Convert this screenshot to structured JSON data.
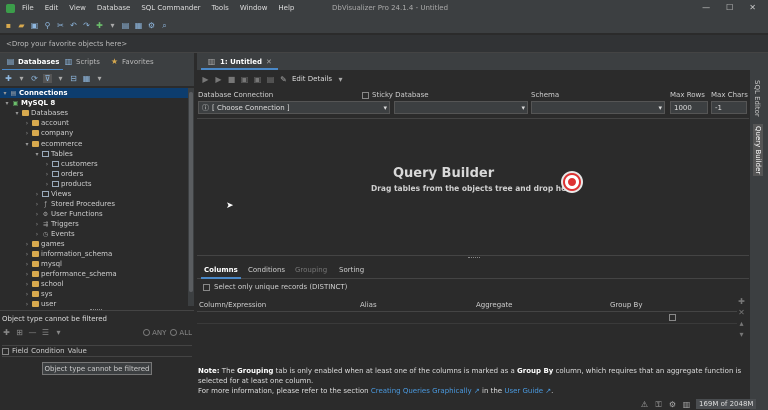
{
  "app": {
    "title": "DbVisualizer Pro 24.1.4 - Untitled",
    "menu": [
      "File",
      "Edit",
      "View",
      "Database",
      "SQL Commander",
      "Tools",
      "Window",
      "Help"
    ]
  },
  "favorites_bar": {
    "placeholder": "<Drop your favorite objects here>"
  },
  "left_tabs": [
    {
      "label": "Databases"
    },
    {
      "label": "Scripts"
    },
    {
      "label": "Favorites"
    }
  ],
  "tree": {
    "connections_label": "Connections",
    "server": "MySQL 8",
    "databases_label": "Databases",
    "dbs_top": [
      "account",
      "company",
      "ecommerce"
    ],
    "ecommerce_children": {
      "tables_label": "Tables",
      "tables": [
        "customers",
        "orders",
        "products"
      ],
      "others": [
        "Views",
        "Stored Procedures",
        "User Functions",
        "Triggers",
        "Events"
      ]
    },
    "dbs_bottom": [
      "games",
      "information_schema",
      "mysql",
      "performance_schema",
      "school",
      "sys",
      "user"
    ]
  },
  "filter_panel": {
    "message": "Object type cannot be filtered",
    "any_label": "ANY",
    "all_label": "ALL",
    "columns": [
      "Field",
      "Condition",
      "Value"
    ],
    "button": "Object type cannot be filtered"
  },
  "editor": {
    "tab_label": "1: Untitled",
    "edit_details": "Edit Details",
    "database_connection_label": "Database Connection",
    "sticky_database_label": "Sticky Database",
    "schema_label": "Schema",
    "max_rows_label": "Max Rows",
    "max_chars_label": "Max Chars",
    "connection_value": "[ Choose Connection ]",
    "max_rows_value": "1000",
    "max_chars_value": "-1"
  },
  "query_builder": {
    "title": "Query Builder",
    "subtitle": "Drag tables from the objects tree and drop here"
  },
  "bottom_tabs": [
    {
      "label": "Columns"
    },
    {
      "label": "Conditions"
    },
    {
      "label": "Grouping"
    },
    {
      "label": "Sorting"
    }
  ],
  "distinct_label": "Select only unique records (DISTINCT)",
  "column_headers": [
    "Column/Expression",
    "Alias",
    "Aggregate",
    "Group By"
  ],
  "note": {
    "prefix": "Note:",
    "t1": " The ",
    "grouping": "Grouping",
    "t2": " tab is only enabled when at least one of the columns is marked as a ",
    "groupby": "Group By",
    "t3": " column, which requires that an aggregate function is selected for at least one column.",
    "line2": "For more information, please refer to the section ",
    "link1": "Creating Queries Graphically ↗",
    "t4": " in the ",
    "link2": "User Guide ↗",
    "t5": "."
  },
  "side_tabs": [
    "SQL Editor",
    "Query Builder"
  ],
  "status": {
    "memory": "169M of 2048M"
  }
}
